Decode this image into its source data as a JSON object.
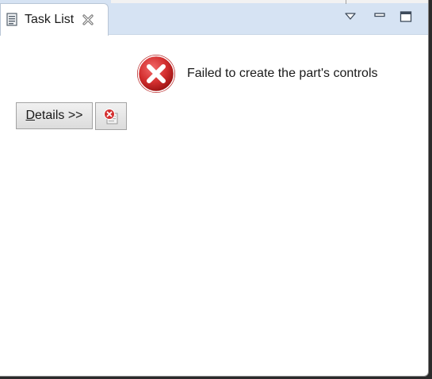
{
  "tab": {
    "title": "Task List",
    "icon": "task-list-icon",
    "close_icon": "close-icon"
  },
  "view_controls": {
    "menu_icon": "view-menu-icon",
    "minimize_icon": "minimize-icon",
    "maximize_icon": "maximize-icon"
  },
  "error": {
    "icon": "error-icon",
    "message": "Failed to create the part's controls"
  },
  "buttons": {
    "details_mnemonic": "D",
    "details_rest": "etails >>",
    "report_icon": "error-log-icon"
  },
  "colors": {
    "tab_bar": "#d6e3f3",
    "error_red": "#d32f2f",
    "panel": "#ffffff"
  }
}
